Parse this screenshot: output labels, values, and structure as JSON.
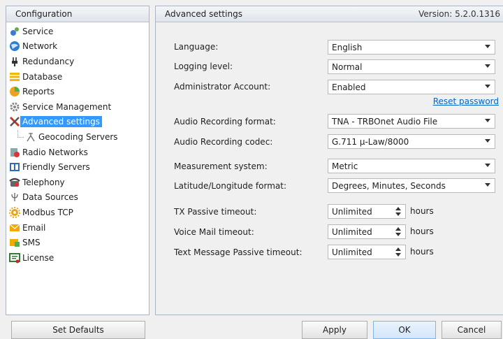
{
  "left_panel": {
    "header": "Configuration",
    "items": [
      {
        "label": "Service",
        "icon": "service-icon"
      },
      {
        "label": "Network",
        "icon": "network-icon"
      },
      {
        "label": "Redundancy",
        "icon": "redundancy-icon"
      },
      {
        "label": "Database",
        "icon": "database-icon"
      },
      {
        "label": "Reports",
        "icon": "reports-icon"
      },
      {
        "label": "Service Management",
        "icon": "service-management-icon"
      },
      {
        "label": "Advanced settings",
        "icon": "advanced-settings-icon",
        "selected": true
      },
      {
        "label": "Geocoding Servers",
        "icon": "geocoding-icon",
        "child": true
      },
      {
        "label": "Radio Networks",
        "icon": "radio-networks-icon"
      },
      {
        "label": "Friendly Servers",
        "icon": "friendly-servers-icon"
      },
      {
        "label": "Telephony",
        "icon": "telephony-icon"
      },
      {
        "label": "Data Sources",
        "icon": "data-sources-icon"
      },
      {
        "label": "Modbus TCP",
        "icon": "modbus-icon"
      },
      {
        "label": "Email",
        "icon": "email-icon"
      },
      {
        "label": "SMS",
        "icon": "sms-icon"
      },
      {
        "label": "License",
        "icon": "license-icon"
      }
    ]
  },
  "right_panel": {
    "header": "Advanced settings",
    "version": "Version: 5.2.0.1316",
    "fields": {
      "language": {
        "label": "Language:",
        "value": "English"
      },
      "logging": {
        "label": "Logging level:",
        "value": "Normal"
      },
      "admin": {
        "label": "Administrator Account:",
        "value": "Enabled"
      },
      "reset_password": "Reset password",
      "audio_format": {
        "label": "Audio Recording format:",
        "value": "TNA - TRBOnet Audio File"
      },
      "audio_codec": {
        "label": "Audio Recording codec:",
        "value": "G.711 µ-Law/8000"
      },
      "measurement": {
        "label": "Measurement system:",
        "value": "Metric"
      },
      "latlon": {
        "label": "Latitude/Longitude format:",
        "value": "Degrees, Minutes, Seconds"
      },
      "tx_timeout": {
        "label": "TX Passive timeout:",
        "value": "Unlimited",
        "unit": "hours"
      },
      "vm_timeout": {
        "label": "Voice Mail timeout:",
        "value": "Unlimited",
        "unit": "hours"
      },
      "text_timeout": {
        "label": "Text Message Passive timeout:",
        "value": "Unlimited",
        "unit": "hours"
      }
    }
  },
  "buttons": {
    "set_defaults": "Set Defaults",
    "apply": "Apply",
    "ok": "OK",
    "cancel": "Cancel"
  }
}
